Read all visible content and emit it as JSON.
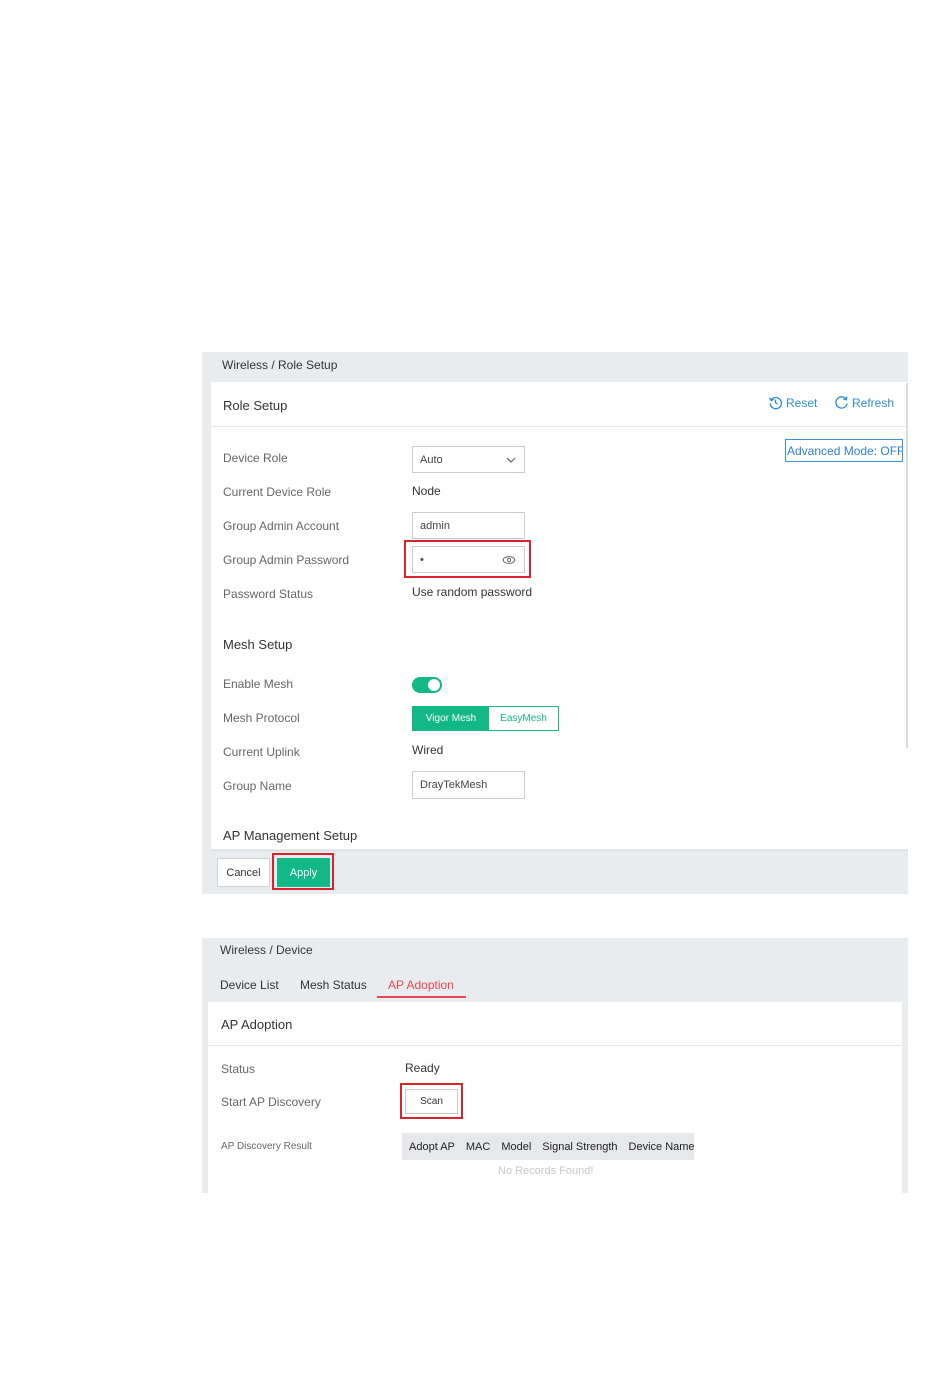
{
  "role_setup_page": {
    "breadcrumb": "Wireless / Role Setup",
    "title": "Role Setup",
    "reset_label": "Reset",
    "refresh_label": "Refresh",
    "advanced_mode_label": "Advanced Mode: OFF",
    "fields": {
      "device_role_label": "Device Role",
      "device_role_value": "Auto",
      "current_device_role_label": "Current Device Role",
      "current_device_role_value": "Node",
      "group_admin_account_label": "Group Admin Account",
      "group_admin_account_value": "admin",
      "group_admin_password_label": "Group Admin Password",
      "group_admin_password_value": "•",
      "password_status_label": "Password Status",
      "password_status_value": "Use random password"
    },
    "mesh": {
      "section_title": "Mesh Setup",
      "enable_mesh_label": "Enable Mesh",
      "enable_mesh_on": true,
      "mesh_protocol_label": "Mesh Protocol",
      "protocol_options": [
        "Vigor Mesh",
        "EasyMesh"
      ],
      "protocol_selected": "Vigor Mesh",
      "current_uplink_label": "Current Uplink",
      "current_uplink_value": "Wired",
      "group_name_label": "Group Name",
      "group_name_value": "DrayTekMesh"
    },
    "ap_management_title": "AP Management Setup",
    "cancel_label": "Cancel",
    "apply_label": "Apply"
  },
  "device_page": {
    "breadcrumb": "Wireless / Device",
    "tabs": [
      {
        "label": "Device List",
        "active": false
      },
      {
        "label": "Mesh Status",
        "active": false
      },
      {
        "label": "AP Adoption",
        "active": true
      }
    ],
    "title": "AP Adoption",
    "status_label": "Status",
    "status_value": "Ready",
    "start_discovery_label": "Start AP Discovery",
    "scan_label": "Scan",
    "result_label": "AP Discovery Result",
    "table_columns": [
      "Adopt AP",
      "MAC",
      "Model",
      "Signal Strength",
      "Device Name"
    ],
    "empty_text": "No Records Found!"
  },
  "colors": {
    "accent_green": "#12b886",
    "link_blue": "#2f8bd8",
    "highlight_red": "#d9232f",
    "tab_active_red": "#e8474f"
  }
}
